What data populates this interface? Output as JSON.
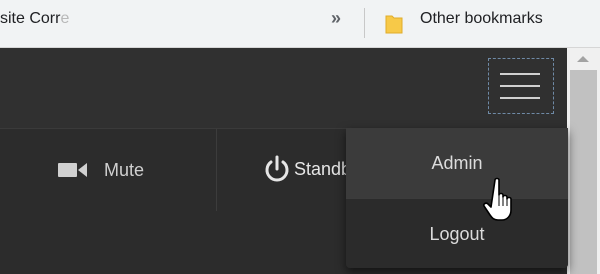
{
  "bookmarks_bar": {
    "truncated_item": "site Corr",
    "truncated_fade": "e",
    "overflow_chevron": "»",
    "other_bookmarks": "Other bookmarks",
    "folder_icon": "folder-icon"
  },
  "header": {
    "menu_icon": "hamburger-icon"
  },
  "controls": {
    "mute_label": "Mute",
    "mute_icon": "video-camera-icon",
    "standby_label": "Standby",
    "standby_icon": "power-icon"
  },
  "dropdown": {
    "items": [
      {
        "label": "Admin"
      },
      {
        "label": "Logout"
      }
    ]
  },
  "colors": {
    "header_bg": "#303030",
    "dropdown_bg": "#2b2b2b",
    "dropdown_hover": "#3b3b3b",
    "text": "#dcdcdc",
    "folder": "#f7c948"
  }
}
